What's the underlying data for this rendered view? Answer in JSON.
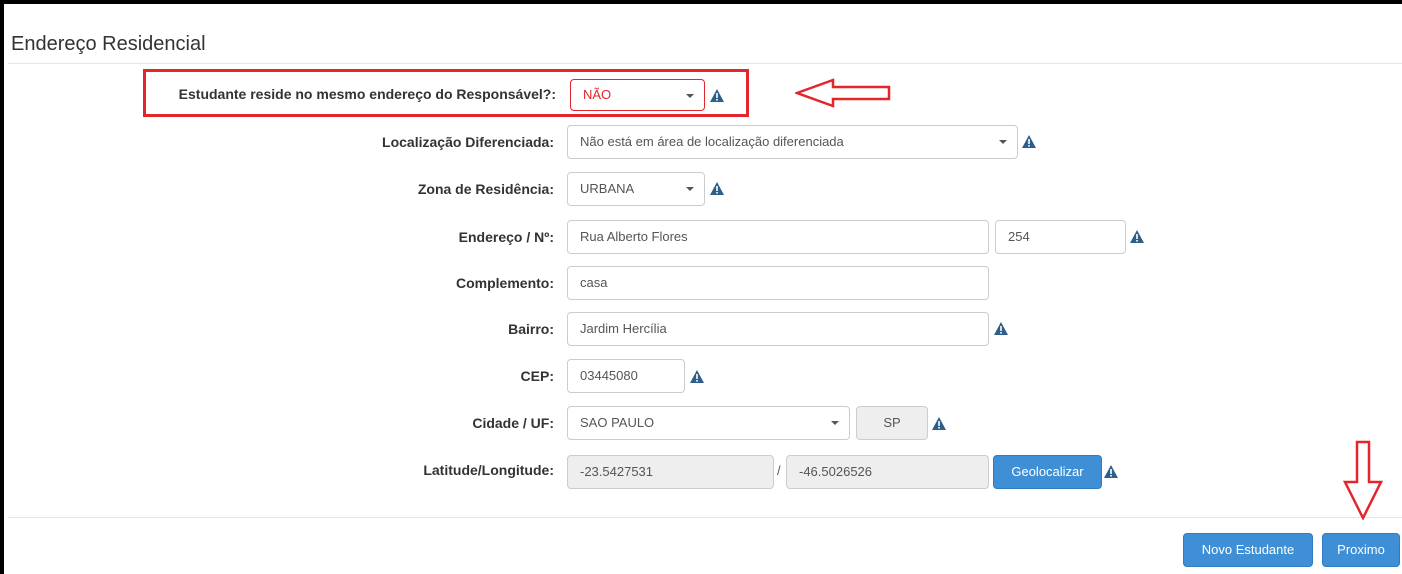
{
  "section": {
    "title": "Endereço Residencial"
  },
  "form": {
    "mesmo_endereco": {
      "label": "Estudante reside no mesmo endereço do Responsável?:",
      "value": "NÃO"
    },
    "localizacao": {
      "label": "Localização Diferenciada:",
      "value": "Não está em área de localização diferenciada"
    },
    "zona": {
      "label": "Zona de Residência:",
      "value": "URBANA"
    },
    "endereco": {
      "label": "Endereço / Nº:",
      "value": "Rua Alberto Flores",
      "numero": "254"
    },
    "complemento": {
      "label": "Complemento:",
      "value": "casa"
    },
    "bairro": {
      "label": "Bairro:",
      "value": "Jardim Hercília"
    },
    "cep": {
      "label": "CEP:",
      "value": "03445080"
    },
    "cidade": {
      "label": "Cidade / UF:",
      "value": "SAO PAULO",
      "uf": "SP"
    },
    "latlong": {
      "label": "Latitude/Longitude:",
      "latitude": "-23.5427531",
      "separator": "/",
      "longitude": "-46.5026526",
      "button": "Geolocalizar"
    }
  },
  "footer": {
    "novo_estudante": "Novo Estudante",
    "proximo": "Proximo"
  },
  "colors": {
    "primary": "#3f8fd6",
    "annotation": "#e3252c",
    "warning_icon": "#2e5f8a"
  }
}
